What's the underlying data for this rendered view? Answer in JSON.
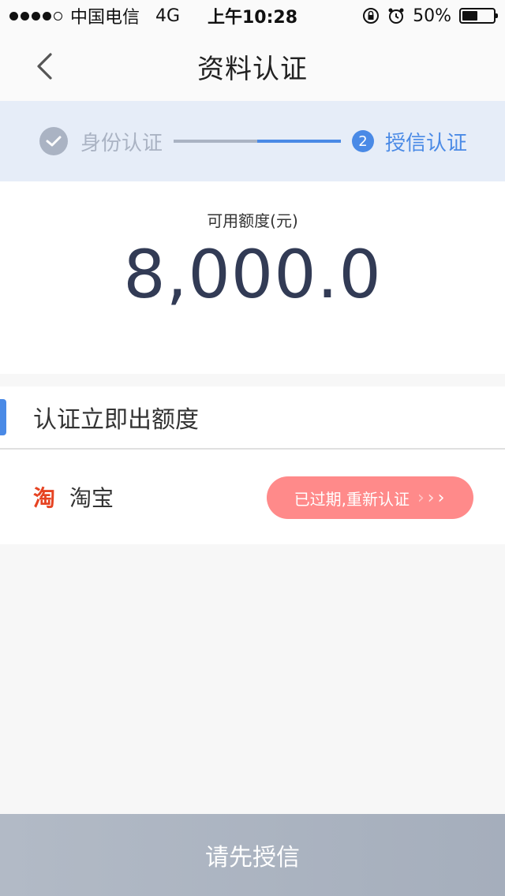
{
  "status_bar": {
    "carrier": "中国电信",
    "network": "4G",
    "time": "上午10:28",
    "battery": "50%",
    "battery_level": 0.5
  },
  "nav": {
    "title": "资料认证",
    "back_icon": "chevron-left-icon"
  },
  "stepper": {
    "step1_label": "身份认证",
    "step2_number": "2",
    "step2_label": "授信认证",
    "active_color": "#4a8ae6",
    "done_color": "#aab3c3"
  },
  "amount": {
    "label": "可用额度(元)",
    "value": "8,000.0"
  },
  "section": {
    "title": "认证立即出额度"
  },
  "items": [
    {
      "icon_text": "淘",
      "label": "淘宝",
      "action_label": "已过期,重新认证",
      "action_color": "#ff8a8a"
    }
  ],
  "footer": {
    "button_label": "请先授信"
  }
}
